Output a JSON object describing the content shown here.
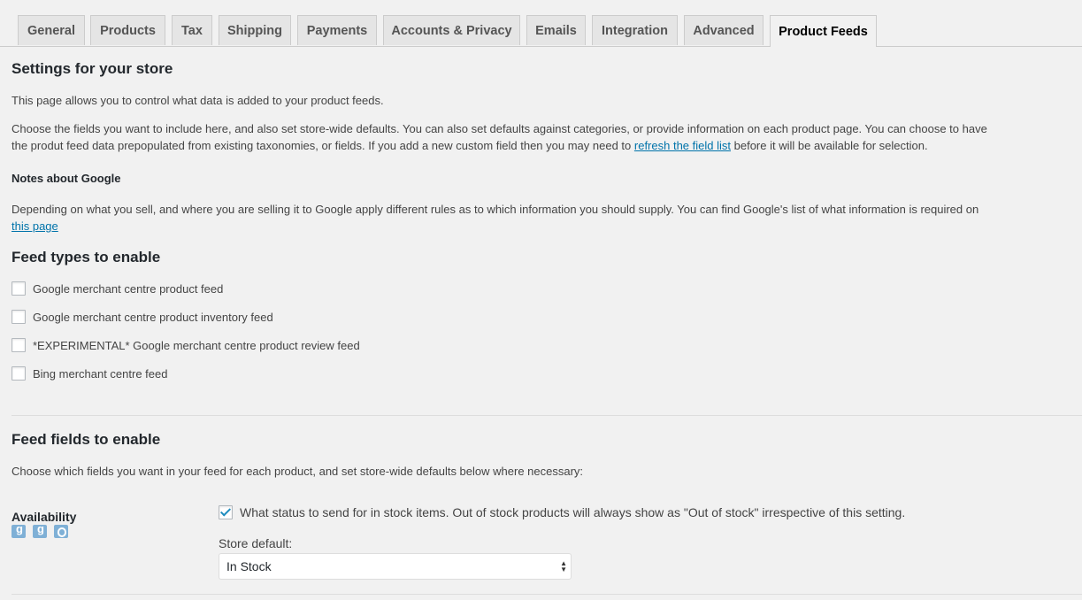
{
  "tabs": [
    {
      "label": "General"
    },
    {
      "label": "Products"
    },
    {
      "label": "Tax"
    },
    {
      "label": "Shipping"
    },
    {
      "label": "Payments"
    },
    {
      "label": "Accounts & Privacy"
    },
    {
      "label": "Emails"
    },
    {
      "label": "Integration"
    },
    {
      "label": "Advanced"
    },
    {
      "label": "Product Feeds",
      "active": true
    }
  ],
  "settings": {
    "title": "Settings for your store",
    "intro": "This page allows you to control what data is added to your product feeds.",
    "choose_text_1": "Choose the fields you want to include here, and also set store-wide defaults. You can also set defaults against categories, or provide information on each product page. You can choose to have",
    "choose_text_2a": "the produt feed data prepopulated from existing taxonomies, or fields. If you add a new custom field then you may need to",
    "refresh_link": "refresh the field list",
    "choose_text_2b": "before it will be available for selection.",
    "notes_heading": "Notes about Google",
    "notes_text": "Depending on what you sell, and where you are selling it to Google apply different rules as to which information you should supply. You can find Google's list of what information is required on",
    "notes_link": "this page"
  },
  "feed_types": {
    "title": "Feed types to enable",
    "items": [
      {
        "label": "Google merchant centre product feed",
        "checked": false
      },
      {
        "label": "Google merchant centre product inventory feed",
        "checked": false
      },
      {
        "label": "*EXPERIMENTAL* Google merchant centre product review feed",
        "checked": false
      },
      {
        "label": "Bing merchant centre feed",
        "checked": false
      }
    ]
  },
  "feed_fields": {
    "title": "Feed fields to enable",
    "description": "Choose which fields you want in your feed for each product, and set store-wide defaults below where necessary:",
    "availability": {
      "label": "Availability",
      "icons": [
        "google-icon",
        "google-icon",
        "bing-icon"
      ],
      "checkbox_label": "What status to send for in stock items. Out of stock products will always show as \"Out of stock\" irrespective of this setting.",
      "checked": true,
      "store_default_label": "Store default:",
      "store_default_value": "In Stock"
    }
  }
}
